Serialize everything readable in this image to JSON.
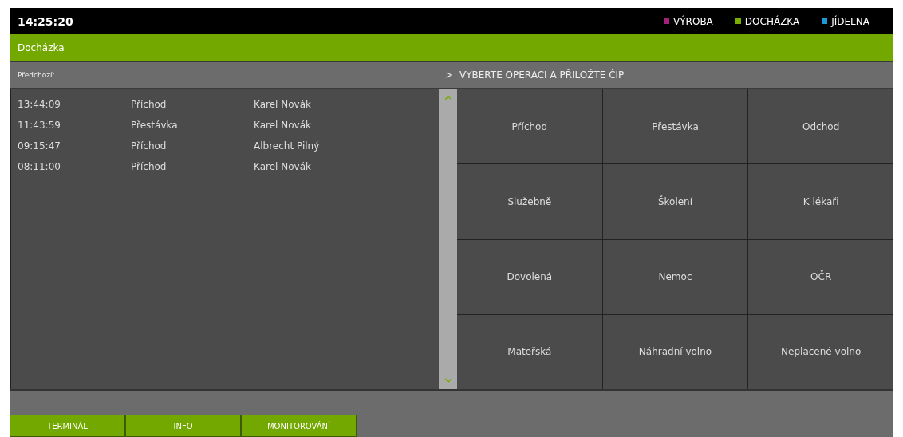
{
  "top_bar": {
    "clock": "14:25:20",
    "legend": [
      {
        "label": "VÝROBA",
        "color": "#a3207c"
      },
      {
        "label": "DOCHÁZKA",
        "color": "#7aad00"
      },
      {
        "label": "JÍDELNA",
        "color": "#1a9ad8"
      }
    ]
  },
  "section_title": "Docházka",
  "header": {
    "previous_label": "Předchozí:",
    "prompt_mark": ">",
    "prompt": "VYBERTE OPERACI A PŘILOŽTE ČIP"
  },
  "history": [
    {
      "time": "13:44:09",
      "operation": "Příchod",
      "person": "Karel Novák"
    },
    {
      "time": "11:43:59",
      "operation": "Přestávka",
      "person": "Karel Novák"
    },
    {
      "time": "09:15:47",
      "operation": "Příchod",
      "person": "Albrecht Pilný"
    },
    {
      "time": "08:11:00",
      "operation": "Příchod",
      "person": "Karel Novák"
    }
  ],
  "operations": [
    "Příchod",
    "Přestávka",
    "Odchod",
    "Služebně",
    "Školení",
    "K lékaři",
    "Dovolená",
    "Nemoc",
    "OČR",
    "Mateřská",
    "Náhradní volno",
    "Neplacené volno"
  ],
  "bottom_tabs": [
    "TERMINÁL",
    "INFO",
    "MONITOROVÁNÍ"
  ]
}
